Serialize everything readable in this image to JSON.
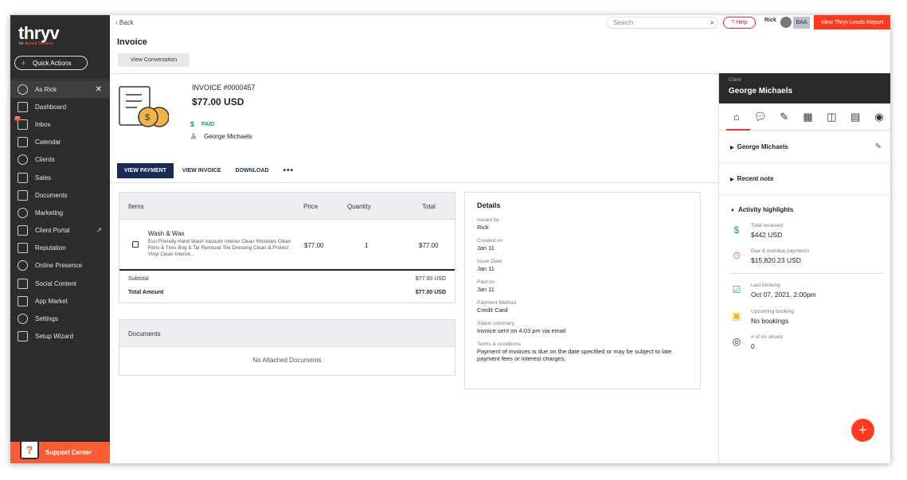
{
  "brand": {
    "logo": "thryv",
    "sub_prefix": "for",
    "sub_highlight": "Animal Services"
  },
  "sidebar": {
    "quick_actions": "Quick Actions",
    "items": [
      {
        "label": "As Rick",
        "icon": "user-icon"
      },
      {
        "label": "Dashboard",
        "icon": "dashboard-icon"
      },
      {
        "label": "Inbox",
        "icon": "inbox-icon",
        "badge": "37"
      },
      {
        "label": "Calendar",
        "icon": "calendar-icon"
      },
      {
        "label": "Clients",
        "icon": "clients-icon"
      },
      {
        "label": "Sales",
        "icon": "sales-icon"
      },
      {
        "label": "Documents",
        "icon": "documents-icon"
      },
      {
        "label": "Marketing",
        "icon": "marketing-icon"
      },
      {
        "label": "Client Portal",
        "icon": "client-portal-icon"
      },
      {
        "label": "Reputation",
        "icon": "reputation-icon"
      },
      {
        "label": "Online Presence",
        "icon": "globe-icon"
      },
      {
        "label": "Social Content",
        "icon": "social-icon"
      },
      {
        "label": "App Market",
        "icon": "app-market-icon"
      },
      {
        "label": "Settings",
        "icon": "settings-icon"
      },
      {
        "label": "Setup Wizard",
        "icon": "wizard-icon"
      }
    ],
    "support": "Support Center"
  },
  "topbar": {
    "back": "Back",
    "search_placeholder": "Search",
    "help": "? Help",
    "user": "Rick",
    "initials": "BAA",
    "leads_button": "View Thryv Leads Report"
  },
  "page": {
    "title": "Invoice",
    "view_conversation": "View Conversation"
  },
  "invoice": {
    "number": "INVOICE #0000457",
    "amount": "$77.00 USD",
    "status": "PAID",
    "client": "George Michaels"
  },
  "tabs": [
    "VIEW PAYMENT",
    "VIEW INVOICE",
    "DOWNLOAD",
    "•••"
  ],
  "items_table": {
    "headers": {
      "items": "Items",
      "price": "Price",
      "quantity": "Quantity",
      "total": "Total"
    },
    "row": {
      "name": "Wash & Wax",
      "description": "Eco-Friendly Hand Wash Vacuum Interior Clean Windows Clean Rims & Tires Bug & Tar Removal Tire Dressing Clean & Protect Vinyl Clean Interior...",
      "price": "$77.00",
      "quantity": "1",
      "total": "$77.00"
    },
    "subtotal_label": "Subtotal",
    "subtotal_value": "$77.00 USD",
    "total_label": "Total Amount",
    "total_value": "$77.00 USD"
  },
  "documents": {
    "title": "Documents",
    "empty": "No Attached Documents"
  },
  "details": {
    "title": "Details",
    "fields": [
      {
        "label": "Issued by",
        "value": "Rick"
      },
      {
        "label": "Created on",
        "value": "Jan 11"
      },
      {
        "label": "Issue Date",
        "value": "Jan 11"
      },
      {
        "label": "Paid on",
        "value": "Jan 11"
      },
      {
        "label": "Payment Method",
        "value": "Credit Card"
      },
      {
        "label": "Status summary",
        "value": "Invoice sent on 4:03 pm via email"
      },
      {
        "label": "Terms & conditions",
        "value": "Payment of invoices is due on the date specified or may be subject to late payment fees or interest charges."
      }
    ]
  },
  "client_panel": {
    "label": "Client",
    "name": "George Michaels",
    "section_client": "George Michaels",
    "section_note": "Recent note",
    "section_activity": "Activity highlights",
    "highlights": [
      {
        "label": "Total received",
        "value": "$442 USD",
        "icon": "money-hand-icon",
        "color": "#1aa15a"
      },
      {
        "label": "Due & overdue payments",
        "value": "$15,820.23 USD",
        "icon": "clock-alert-icon",
        "color": "#e33"
      },
      {
        "label": "Last booking",
        "value": "Oct 07, 2021, 2:00pm",
        "icon": "calendar-check-icon",
        "color": "#1aa15a"
      },
      {
        "label": "Upcoming booking",
        "value": "No bookings",
        "icon": "calendar-upcoming-icon",
        "color": "#e6b800"
      },
      {
        "label": "# of no shows",
        "value": "0",
        "icon": "eye-off-icon",
        "color": "#1a2a55"
      }
    ]
  },
  "fab": "+"
}
